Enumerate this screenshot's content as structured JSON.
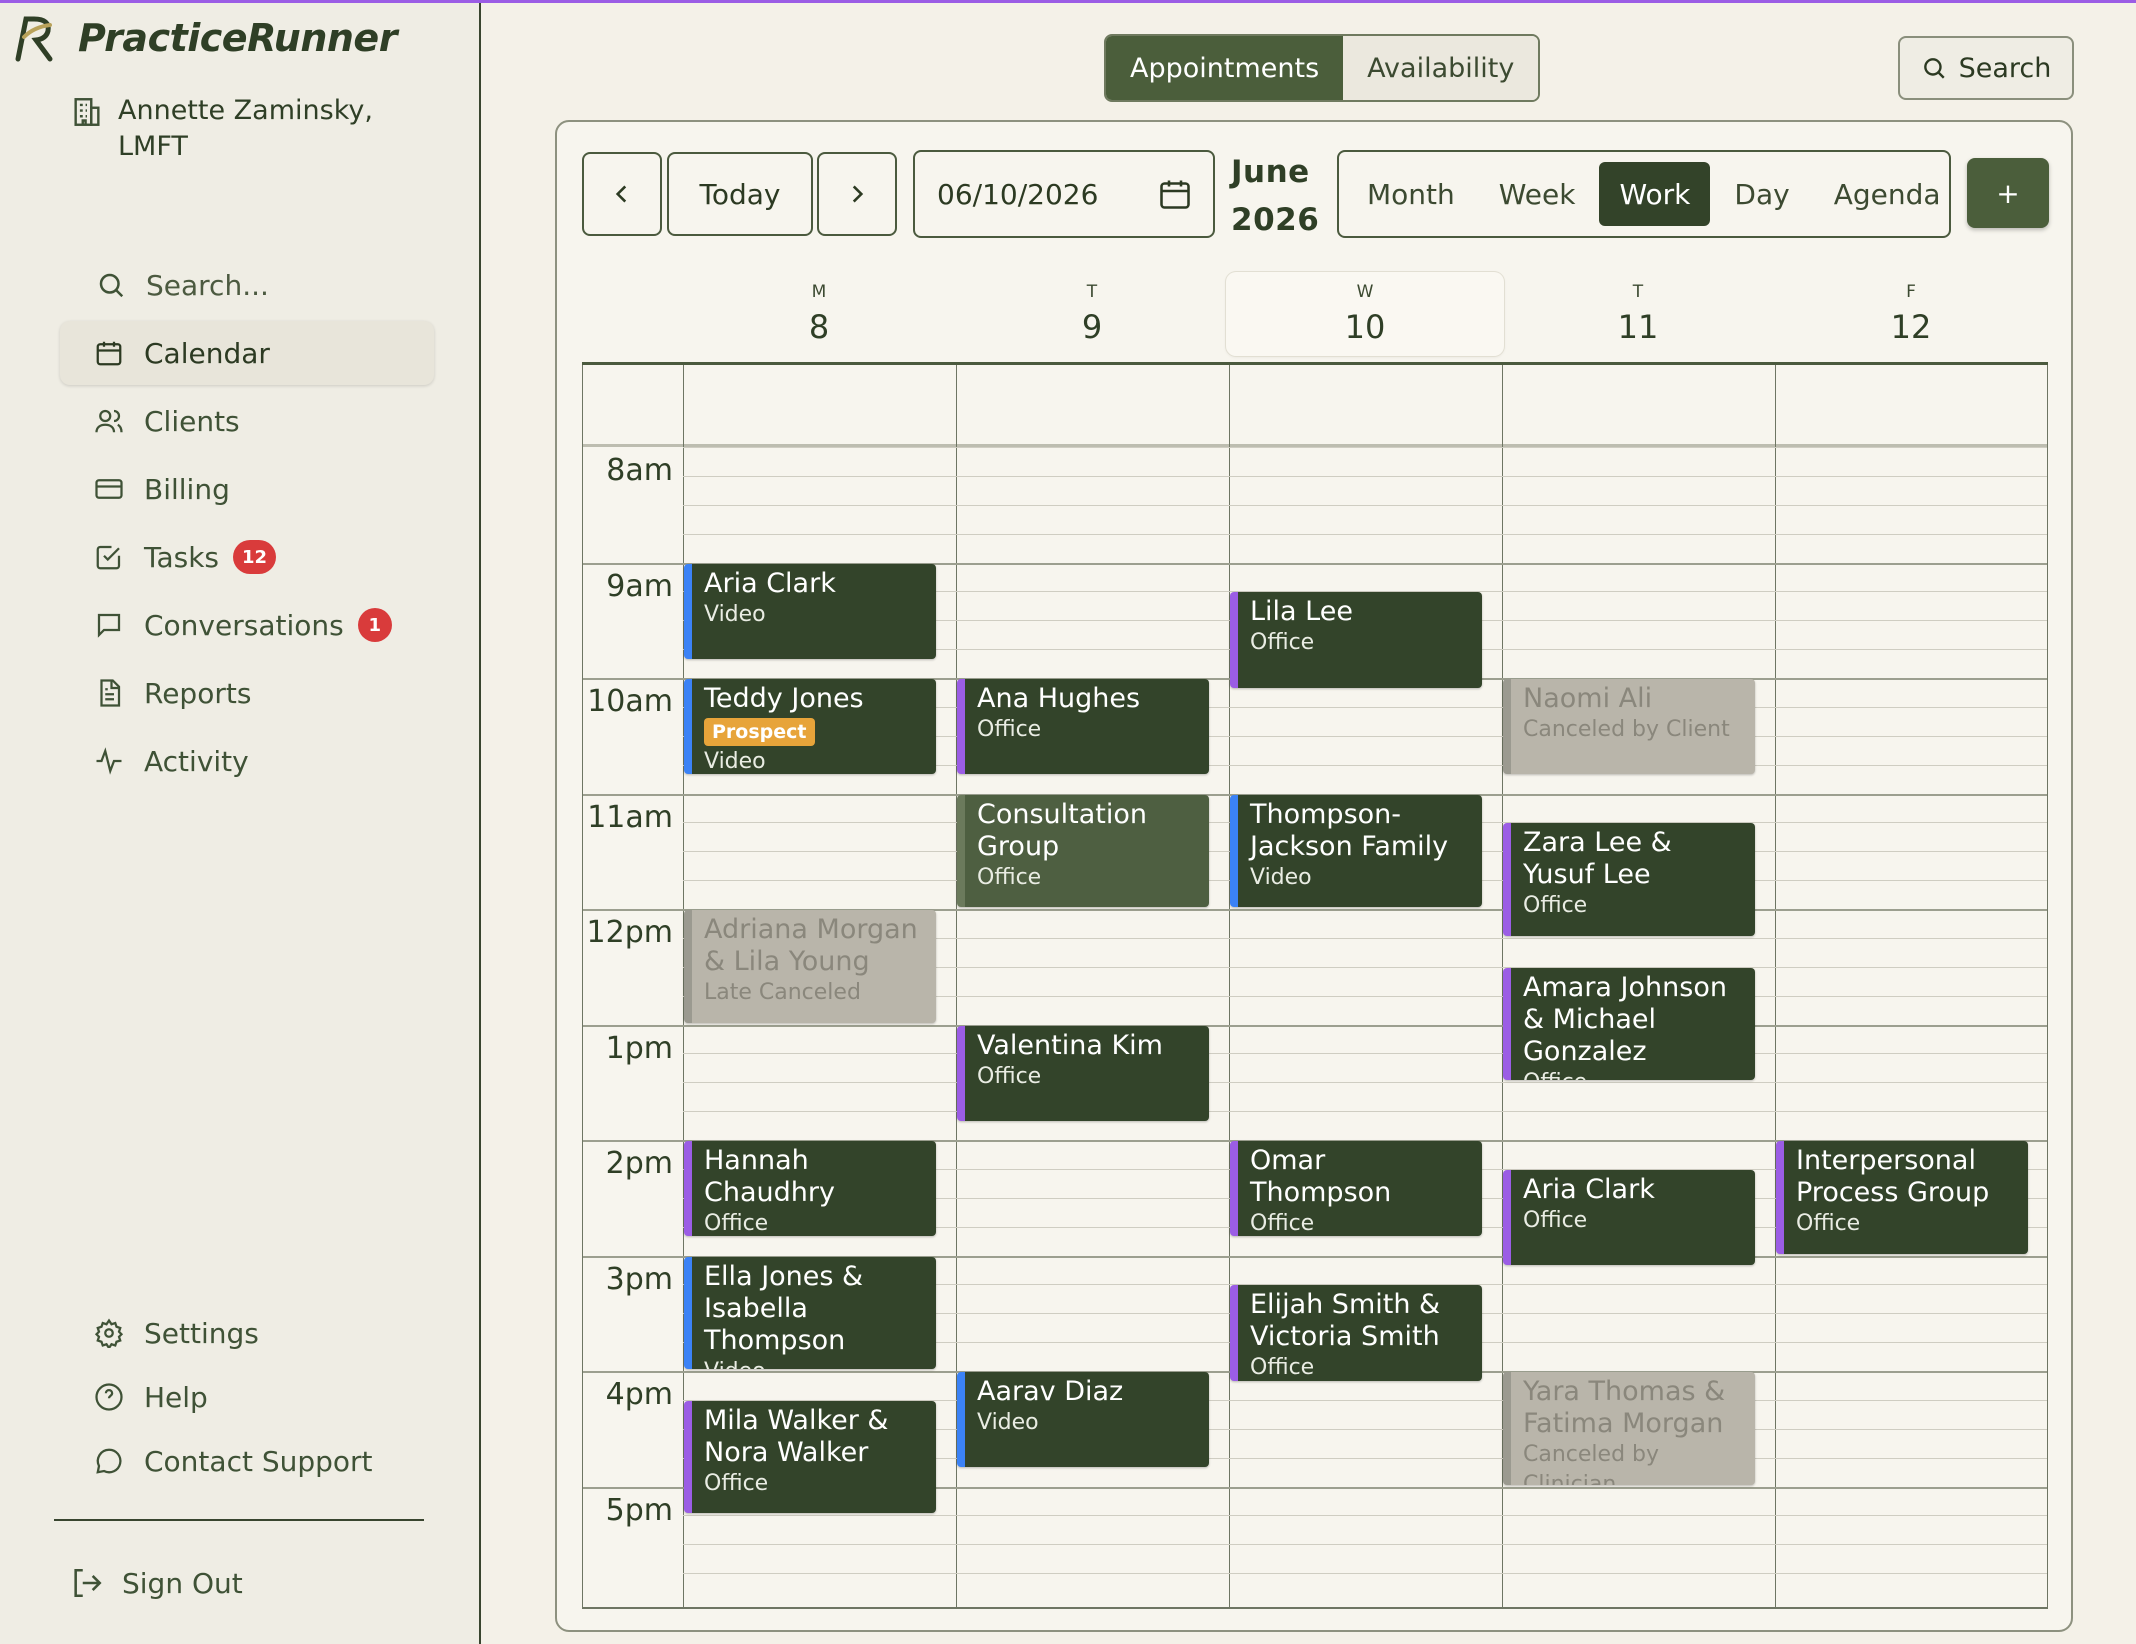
{
  "app": {
    "name": "PracticeRunner"
  },
  "org": {
    "name": "Annette Zaminsky, LMFT"
  },
  "nav": {
    "search": "Search...",
    "calendar": "Calendar",
    "clients": "Clients",
    "billing": "Billing",
    "tasks": "Tasks",
    "tasks_badge": "12",
    "conversations": "Conversations",
    "conversations_badge": "1",
    "reports": "Reports",
    "activity": "Activity",
    "settings": "Settings",
    "help": "Help",
    "support": "Contact Support",
    "signout": "Sign Out"
  },
  "tabs": {
    "appointments": "Appointments",
    "availability": "Availability"
  },
  "search_button": "Search",
  "toolbar": {
    "today": "Today",
    "date": "06/10/2026",
    "month": "June",
    "year": "2026",
    "views": {
      "month": "Month",
      "week": "Week",
      "work": "Work",
      "day": "Day",
      "agenda": "Agenda"
    },
    "add": "+"
  },
  "days": [
    {
      "letter": "M",
      "num": "8"
    },
    {
      "letter": "T",
      "num": "9"
    },
    {
      "letter": "W",
      "num": "10"
    },
    {
      "letter": "T",
      "num": "11"
    },
    {
      "letter": "F",
      "num": "12"
    }
  ],
  "hours": [
    "8am",
    "9am",
    "10am",
    "11am",
    "12pm",
    "1pm",
    "2pm",
    "3pm",
    "4pm",
    "5pm"
  ],
  "events": [
    {
      "day": 0,
      "start": 9.0,
      "dur": 0.85,
      "name": "Aria Clark",
      "loc": "Video",
      "kind": "video"
    },
    {
      "day": 0,
      "start": 10.0,
      "dur": 0.85,
      "name": "Teddy Jones",
      "tag": "Prospect",
      "loc": "Video",
      "kind": "video"
    },
    {
      "day": 0,
      "start": 12.0,
      "dur": 1.0,
      "name": "Adriana Morgan & Lila Young",
      "loc": "Late Canceled",
      "kind": "canceled"
    },
    {
      "day": 0,
      "start": 14.0,
      "dur": 0.85,
      "name": "Hannah Chaudhry",
      "loc": "Office",
      "kind": "office"
    },
    {
      "day": 0,
      "start": 15.0,
      "dur": 1.0,
      "name": "Ella Jones & Isabella Thompson",
      "loc": "Video",
      "kind": "video"
    },
    {
      "day": 0,
      "start": 16.25,
      "dur": 1.0,
      "name": "Mila Walker & Nora Walker",
      "loc": "Office",
      "kind": "office"
    },
    {
      "day": 1,
      "start": 10.0,
      "dur": 0.85,
      "name": "Ana Hughes",
      "loc": "Office",
      "kind": "office"
    },
    {
      "day": 1,
      "start": 11.0,
      "dur": 1.0,
      "name": "Consultation Group",
      "loc": "Office",
      "kind": "group"
    },
    {
      "day": 1,
      "start": 13.0,
      "dur": 0.85,
      "name": "Valentina Kim",
      "loc": "Office",
      "kind": "office"
    },
    {
      "day": 1,
      "start": 16.0,
      "dur": 0.85,
      "name": "Aarav Diaz",
      "loc": "Video",
      "kind": "video"
    },
    {
      "day": 2,
      "start": 9.25,
      "dur": 0.85,
      "name": "Lila Lee",
      "loc": "Office",
      "kind": "office"
    },
    {
      "day": 2,
      "start": 11.0,
      "dur": 1.0,
      "name": "Thompson-Jackson Family",
      "loc": "Video",
      "kind": "video"
    },
    {
      "day": 2,
      "start": 14.0,
      "dur": 0.85,
      "name": "Omar Thompson",
      "loc": "Office",
      "kind": "office"
    },
    {
      "day": 2,
      "start": 15.25,
      "dur": 0.85,
      "name": "Elijah Smith & Victoria Smith",
      "loc": "Office",
      "kind": "office"
    },
    {
      "day": 3,
      "start": 10.0,
      "dur": 0.85,
      "name": "Naomi Ali",
      "loc": "Canceled by Client",
      "kind": "canceled"
    },
    {
      "day": 3,
      "start": 11.25,
      "dur": 1.0,
      "name": "Zara Lee & Yusuf Lee",
      "loc": "Office",
      "kind": "office"
    },
    {
      "day": 3,
      "start": 12.5,
      "dur": 1.0,
      "name": "Amara Johnson & Michael Gonzalez",
      "loc": "Office",
      "kind": "office"
    },
    {
      "day": 3,
      "start": 14.25,
      "dur": 0.85,
      "name": "Aria Clark",
      "loc": "Office",
      "kind": "office"
    },
    {
      "day": 3,
      "start": 16.0,
      "dur": 1.0,
      "name": "Yara Thomas & Fatima Morgan",
      "loc": "Canceled by Clinician",
      "kind": "canceled"
    },
    {
      "day": 4,
      "start": 14.0,
      "dur": 1.0,
      "name": "Interpersonal Process Group",
      "loc": "Office",
      "kind": "office"
    }
  ]
}
